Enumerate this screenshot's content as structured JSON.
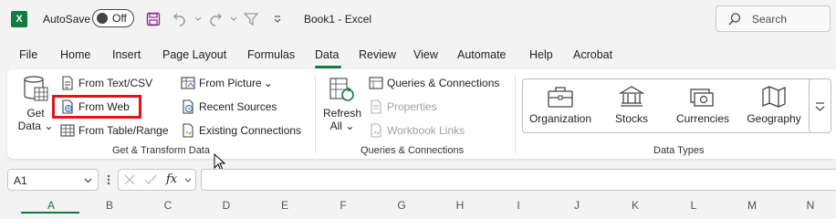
{
  "title_bar": {
    "app_logo": "X",
    "autosave_label": "AutoSave",
    "autosave_state": "Off",
    "doc_title": "Book1  -  Excel",
    "search_placeholder": "Search"
  },
  "tabs": [
    "File",
    "Home",
    "Insert",
    "Page Layout",
    "Formulas",
    "Data",
    "Review",
    "View",
    "Automate",
    "Help",
    "Acrobat"
  ],
  "active_tab": "Data",
  "ribbon": {
    "get_transform": {
      "group_label": "Get & Transform Data",
      "get_data_line1": "Get",
      "get_data_line2": "Data",
      "from_text_csv": "From Text/CSV",
      "from_web": "From Web",
      "from_table_range": "From Table/Range",
      "from_picture": "From Picture",
      "recent_sources": "Recent Sources",
      "existing_connections": "Existing Connections"
    },
    "queries": {
      "group_label": "Queries & Connections",
      "refresh_line1": "Refresh",
      "refresh_line2": "All",
      "queries_connections": "Queries & Connections",
      "properties": "Properties",
      "workbook_links": "Workbook Links"
    },
    "data_types": {
      "group_label": "Data Types",
      "items": [
        "Organization",
        "Stocks",
        "Currencies",
        "Geography"
      ]
    }
  },
  "formula_bar": {
    "name_box": "A1",
    "fx": "fx"
  },
  "columns": [
    "A",
    "B",
    "C",
    "D",
    "E",
    "F",
    "G",
    "H",
    "I",
    "J",
    "K",
    "L",
    "M",
    "N"
  ],
  "colors": {
    "accent": "#107c41",
    "highlight": "#e0141a"
  }
}
